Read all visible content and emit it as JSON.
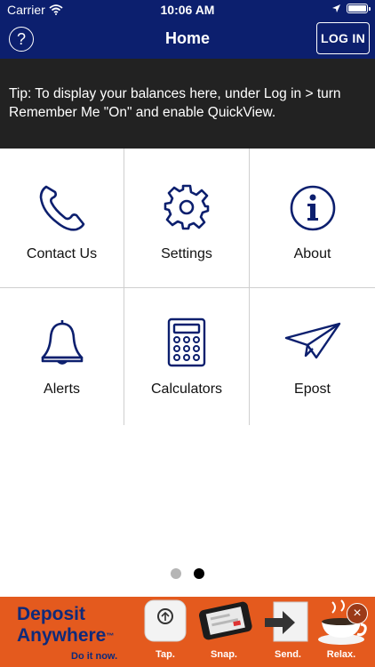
{
  "status_bar": {
    "carrier": "Carrier",
    "time": "10:06 AM"
  },
  "header": {
    "title": "Home",
    "help_label": "?",
    "login_label": "LOG IN"
  },
  "tip": {
    "text": "Tip: To display your balances here, under Log in > turn Remember Me \"On\" and enable QuickView."
  },
  "menu": {
    "items": [
      {
        "label": "Contact Us",
        "icon": "phone-icon"
      },
      {
        "label": "Settings",
        "icon": "gear-icon"
      },
      {
        "label": "About",
        "icon": "info-icon"
      },
      {
        "label": "Alerts",
        "icon": "bell-icon"
      },
      {
        "label": "Calculators",
        "icon": "calculator-icon"
      },
      {
        "label": "Epost",
        "icon": "paper-plane-icon"
      }
    ]
  },
  "pager": {
    "pages": 2,
    "current": 2
  },
  "ad": {
    "title_line1": "Deposit",
    "title_line2": "Anywhere",
    "trademark": "™",
    "tagline": "Do it now.",
    "steps": [
      {
        "label": "Tap."
      },
      {
        "label": "Snap."
      },
      {
        "label": "Send."
      },
      {
        "label": "Relax."
      }
    ],
    "close_label": "×"
  },
  "colors": {
    "header_bg": "#0c1f6e",
    "tip_bg": "#222222",
    "icon_color": "#0c1f6e",
    "ad_bg": "#e45a1e"
  }
}
